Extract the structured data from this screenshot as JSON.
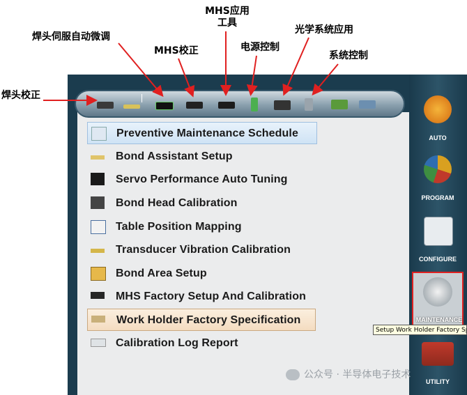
{
  "annotations": {
    "bond_head_cal": "焊头校正",
    "bond_head_servo": "焊头伺服自动微调",
    "mhs_cal": "MHS校正",
    "mhs_tools": "MHS应用工具",
    "power_control": "电源控制",
    "optics_app": "光学系统应用",
    "system_control": "系统控制"
  },
  "toolbar": {
    "icons": [
      "bond-head-calibration-icon",
      "bond-assistant-icon",
      "servo-tuning-icon",
      "mhs-calibration-icon",
      "mhs-tools-icon",
      "power-control-icon",
      "optics-camera-icon",
      "system-control-icon",
      "report-chart-icon",
      "log-viewer-icon"
    ]
  },
  "menu": {
    "items": [
      {
        "label": "Preventive Maintenance Schedule",
        "icon": "schedule-icon"
      },
      {
        "label": "Bond Assistant Setup",
        "icon": "bond-assistant-icon"
      },
      {
        "label": "Servo Performance Auto Tuning",
        "icon": "servo-monitor-icon"
      },
      {
        "label": "Bond Head Calibration",
        "icon": "bond-head-icon"
      },
      {
        "label": "Table Position Mapping",
        "icon": "table-map-icon"
      },
      {
        "label": "Transducer Vibration Calibration",
        "icon": "transducer-icon"
      },
      {
        "label": "Bond Area Setup",
        "icon": "bond-area-icon"
      },
      {
        "label": "MHS Factory Setup And Calibration",
        "icon": "mhs-factory-icon"
      },
      {
        "label": "Work Holder Factory Specification",
        "icon": "work-holder-icon"
      },
      {
        "label": "Calibration Log Report",
        "icon": "log-report-icon"
      }
    ]
  },
  "sidebar": {
    "auto": "AUTO",
    "program": "PROGRAM",
    "configure": "CONFIGURE",
    "maintenance": "MAINTENANCE",
    "utility": "UTILITY"
  },
  "tooltip": "Setup Work Holder Factory Sp",
  "watermark": "公众号 · 半导体电子技术",
  "colors": {
    "frame": "#1b3c4e",
    "arrow": "#e02020",
    "selected_blue": "#cfe3f5",
    "selected_tan": "#f4dcc0"
  }
}
